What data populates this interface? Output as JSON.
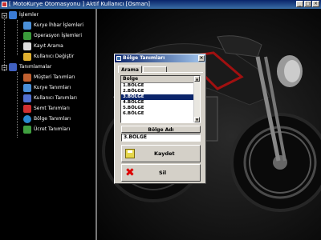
{
  "app": {
    "title": "[ MotoKurye Otomasyonu ] Aktif Kullanıcı [Osman]",
    "window_buttons": [
      "_",
      "□",
      "×"
    ]
  },
  "sidebar": {
    "groups": [
      {
        "label": "İşlemler",
        "icon": "users-icon",
        "items": [
          {
            "label": "Kurye İhbar İşlemleri",
            "icon": "courier-icon"
          },
          {
            "label": "Operasyon İşlemleri",
            "icon": "operation-icon"
          },
          {
            "label": "Kayıt Arama",
            "icon": "search-icon"
          },
          {
            "label": "Kullanıcı Değiştir",
            "icon": "key-icon"
          }
        ]
      },
      {
        "label": "Tanımlamalar",
        "icon": "book-icon",
        "items": [
          {
            "label": "Müşteri Tanımları",
            "icon": "customer-icon"
          },
          {
            "label": "Kurye Tanımları",
            "icon": "courier-icon"
          },
          {
            "label": "Kullanıcı Tanımları",
            "icon": "user-icon"
          },
          {
            "label": "Semt Tanımları",
            "icon": "flag-icon"
          },
          {
            "label": "Bölge Tanımları",
            "icon": "globe-icon"
          },
          {
            "label": "Ücret Tanımları",
            "icon": "money-icon"
          }
        ]
      }
    ]
  },
  "dialog": {
    "title": "Bölge Tanımları",
    "close": "×",
    "tab_label": "Arama",
    "list_header": "Bolge",
    "rows": [
      "1.BÖLGE",
      "2.BÖLGE",
      "3.BÖLGE",
      "4.BÖLGE",
      "5.BÖLGE",
      "6.BÖLGE"
    ],
    "selected_row": "3.BÖLGE",
    "field_label": "Bölge Adı",
    "field_value": "3.BÖLGE",
    "save_label": "Kaydet",
    "delete_label": "Sil",
    "delete_icon_glyph": "✖"
  },
  "colors": {
    "title_bar": "#0a246a",
    "selection": "#0a246a",
    "dialog_face": "#d4d0c8"
  }
}
